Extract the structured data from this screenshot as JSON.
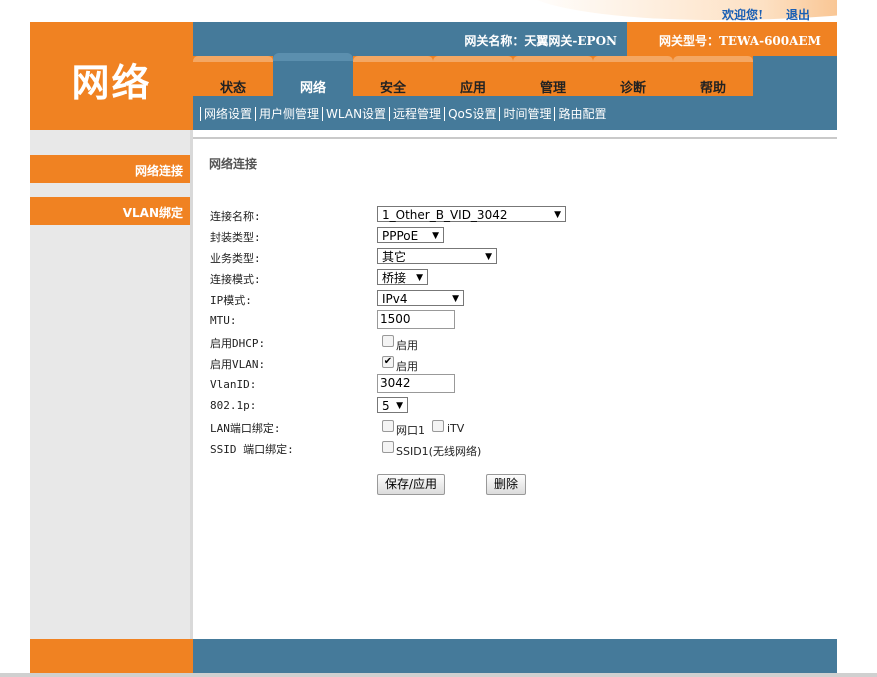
{
  "header": {
    "welcome": "欢迎您!",
    "logout": "退出",
    "logo": "网络",
    "gateway_name": "网关名称：天翼网关-EPON",
    "gateway_model": "网关型号：TEWA-600AEM"
  },
  "tabs": [
    {
      "label": "状态"
    },
    {
      "label": "网络"
    },
    {
      "label": "安全"
    },
    {
      "label": "应用"
    },
    {
      "label": "管理"
    },
    {
      "label": "诊断"
    },
    {
      "label": "帮助"
    }
  ],
  "subnav": [
    "网络设置",
    "用户侧管理",
    "WLAN设置",
    "远程管理",
    "QoS设置",
    "时间管理",
    "路由配置"
  ],
  "sidebar": {
    "items": [
      {
        "label": "网络连接"
      },
      {
        "label": "VLAN绑定"
      }
    ]
  },
  "main": {
    "title": "网络连接",
    "labels": {
      "conn_name": "连接名称:",
      "encap": "封装类型:",
      "service": "业务类型:",
      "mode": "连接模式:",
      "ip_mode": "IP模式:",
      "mtu": "MTU:",
      "dhcp": "启用DHCP:",
      "vlan": "启用VLAN:",
      "vlanid": "VlanID:",
      "p8021": "802.1p:",
      "lan_bind": "LAN端口绑定:",
      "ssid_bind": "SSID 端口绑定:"
    },
    "values": {
      "conn_name": "1_Other_B_VID_3042",
      "encap": "PPPoE",
      "service": "其它",
      "mode": "桥接",
      "ip_mode": "IPv4",
      "mtu": "1500",
      "dhcp_label": "启用",
      "dhcp_checked": false,
      "vlan_label": "启用",
      "vlan_checked": true,
      "vlanid": "3042",
      "p8021": "5",
      "lan1": "网口1",
      "itv": "iTV",
      "ssid1": "SSID1(无线网络)"
    },
    "save_button": "保存/应用",
    "delete_button": "删除"
  }
}
